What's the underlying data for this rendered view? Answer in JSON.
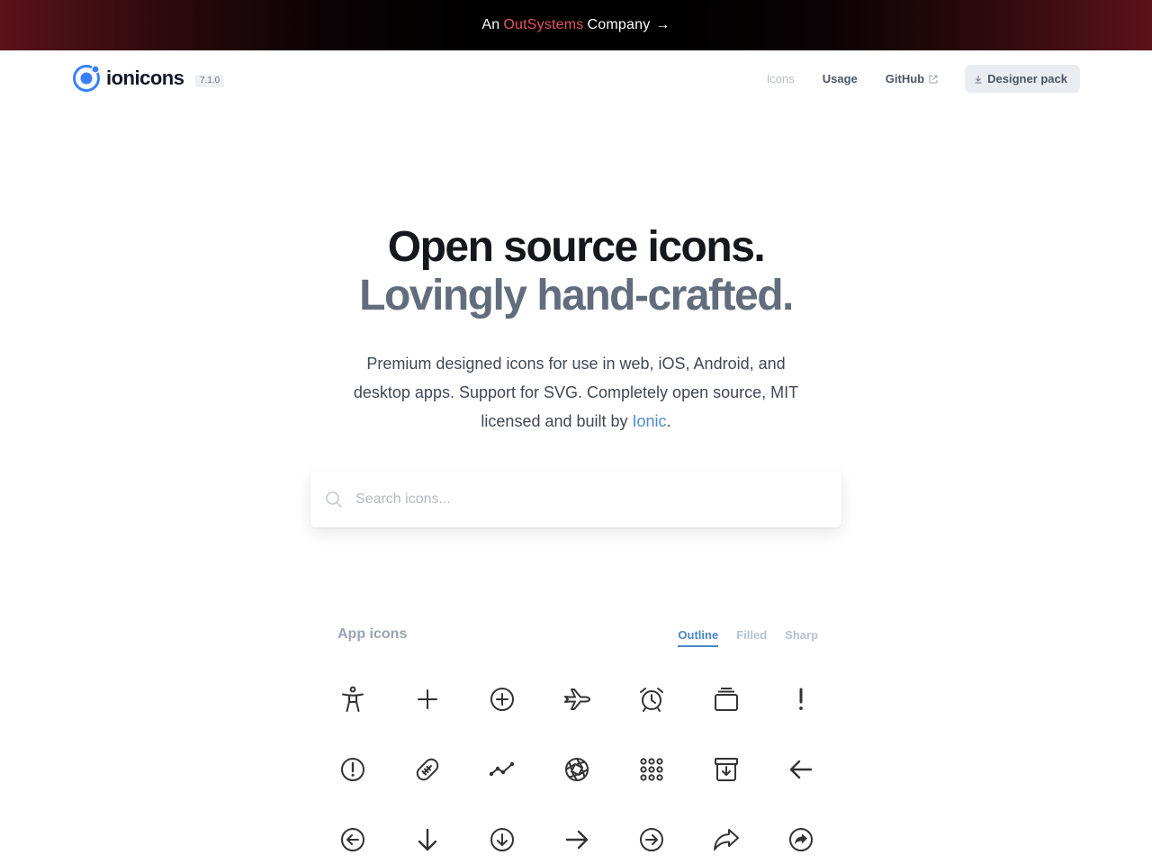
{
  "banner": {
    "prefix": "An",
    "brand": "OutSystems",
    "suffix": "Company",
    "arrow": "→"
  },
  "header": {
    "logo_text": "ionicons",
    "logo_icon": "ionic-logo-icon",
    "version": "7.1.0",
    "nav": [
      {
        "label": "Icons",
        "active": true
      },
      {
        "label": "Usage",
        "active": false
      },
      {
        "label": "GitHub",
        "active": false,
        "icon": "external-link-icon"
      }
    ],
    "designer_pack": {
      "label": "Designer pack",
      "icon": "download-icon"
    }
  },
  "hero": {
    "title_line1": "Open source icons.",
    "title_line2": "Lovingly hand-crafted.",
    "desc_text": "Premium designed icons for use in web, iOS, Android, and desktop apps. Support for SVG. Completely open source, MIT licensed and built by ",
    "desc_link": "Ionic",
    "desc_end": "."
  },
  "search": {
    "placeholder": "Search icons...",
    "value": "",
    "icon": "search-icon"
  },
  "icons_section": {
    "title": "App icons",
    "tabs": [
      {
        "label": "Outline",
        "active": true
      },
      {
        "label": "Filled",
        "active": false
      },
      {
        "label": "Sharp",
        "active": false
      }
    ],
    "icons": [
      "accessibility-icon",
      "add-icon",
      "add-circle-icon",
      "airplane-icon",
      "alarm-icon",
      "albums-icon",
      "alert-icon",
      "alert-circle-icon",
      "american-football-icon",
      "analytics-icon",
      "aperture-icon",
      "apps-icon",
      "archive-icon",
      "arrow-back-icon",
      "arrow-back-circle-icon",
      "arrow-down-icon",
      "arrow-down-circle-icon",
      "arrow-forward-icon",
      "arrow-forward-circle-icon",
      "arrow-redo-icon",
      "arrow-redo-circle-icon"
    ]
  },
  "colors": {
    "brand_accent": "#e4545d",
    "link": "#4f8bd1",
    "tab_active": "#4a86c7",
    "title_dark": "#14171c",
    "title_gray": "#616d7c"
  }
}
